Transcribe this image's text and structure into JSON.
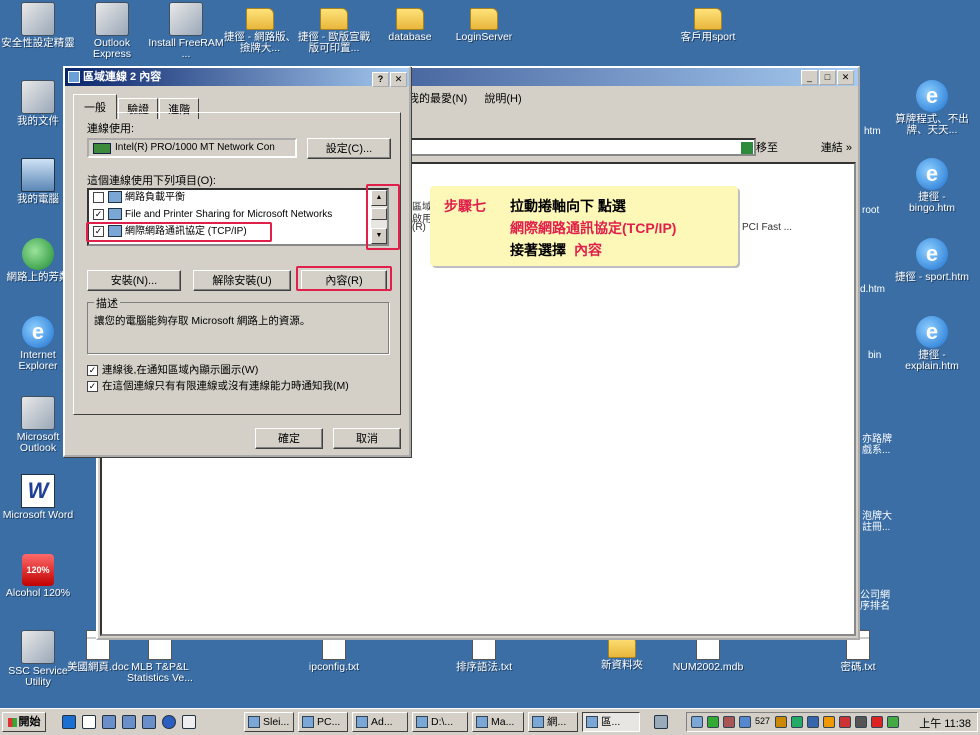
{
  "desktop_icons_top": [
    {
      "name": "desk-icon-security-settings",
      "label": "安全性設定精靈",
      "icon": "wizard-icon"
    },
    {
      "name": "desk-icon-outlook-express",
      "label": "Outlook Express",
      "icon": "outlook-express-icon"
    },
    {
      "name": "desk-icon-install-freeram",
      "label": "Install FreeRAM ...",
      "icon": "ram-chip-icon"
    },
    {
      "name": "desk-icon-shortcut-netplay",
      "label": "捷徑 - 網路版、撿牌大...",
      "icon": "folder-icon"
    },
    {
      "name": "desk-icon-shortcut-oubandian",
      "label": "捷徑 - 歐版宣戰版可印置...",
      "icon": "folder-icon"
    },
    {
      "name": "desk-icon-database",
      "label": "database",
      "icon": "folder-icon"
    },
    {
      "name": "desk-icon-loginserver",
      "label": "LoginServer",
      "icon": "folder-icon"
    },
    {
      "name": "desk-icon-client-sport",
      "label": "客戶用sport",
      "icon": "folder-icon"
    }
  ],
  "desktop_icons_left": [
    {
      "name": "desk-icon-my-documents",
      "label": "我的文件",
      "icon": "my-documents-icon"
    },
    {
      "name": "desk-icon-my-computer",
      "label": "我的電腦",
      "icon": "my-computer-icon"
    },
    {
      "name": "desk-icon-network-places",
      "label": "網路上的芳鄰",
      "icon": "network-icon"
    },
    {
      "name": "desk-icon-internet-explorer",
      "label": "Internet Explorer",
      "icon": "ie-icon"
    },
    {
      "name": "desk-icon-microsoft-outlook",
      "label": "Microsoft Outlook",
      "icon": "outlook-icon"
    },
    {
      "name": "desk-icon-microsoft-word",
      "label": "Microsoft Word",
      "icon": "word-icon"
    },
    {
      "name": "desk-icon-alcohol",
      "label": "Alcohol 120%",
      "icon": "alcohol-icon"
    }
  ],
  "desktop_icons_right": [
    {
      "name": "desk-icon-html-suanpai",
      "label": "算牌程式、不出牌、天天...",
      "icon": "html-doc-icon"
    },
    {
      "name": "desk-icon-html-bingo",
      "label": "捷徑 - bingo.htm",
      "icon": "html-doc-icon"
    },
    {
      "name": "desk-icon-html-sport",
      "label": "捷徑 - sport.htm",
      "icon": "html-doc-icon"
    },
    {
      "name": "desk-icon-html-explain",
      "label": "捷徑 - explain.htm",
      "icon": "html-doc-icon"
    }
  ],
  "desktop_icons_bottom": [
    {
      "name": "desk-icon-ssc-service",
      "label": "SSC Service Utility",
      "icon": "printer-icon"
    },
    {
      "name": "desk-icon-meiguo-doc",
      "label": "美國網頁.doc",
      "icon": "word-doc-icon"
    },
    {
      "name": "desk-icon-mlb-stats",
      "label": "MLB T&P&L Statistics Ve...",
      "icon": "doc-icon"
    },
    {
      "name": "desk-icon-ipconfig",
      "label": "ipconfig.txt",
      "icon": "text-file-icon"
    },
    {
      "name": "desk-icon-paixu",
      "label": "排序語法.txt",
      "icon": "text-file-icon"
    },
    {
      "name": "desk-icon-new-folder",
      "label": "新資料夾",
      "icon": "folder-icon"
    },
    {
      "name": "desk-icon-num2002",
      "label": "NUM2002.mdb",
      "icon": "access-db-icon"
    },
    {
      "name": "desk-icon-mima",
      "label": "密碼.txt",
      "icon": "text-file-icon"
    }
  ],
  "background_window": {
    "menu_items": [
      "我的最愛(N)",
      "說明(H)"
    ],
    "go_label": "移至",
    "links_label": "連結",
    "fragments": [
      "區域連",
      "啟用",
      "(R)",
      "PCI Fast ...",
      "htm",
      "root",
      "d.htm",
      "bin",
      "亦路牌",
      "戲系...",
      "泡牌大",
      "註冊...",
      "公司網",
      "序排名"
    ]
  },
  "dialog": {
    "title": "區域連線 2 內容",
    "help_btn": "?",
    "close_btn": "✕",
    "tabs": [
      "一般",
      "驗證",
      "進階"
    ],
    "connect_using_label": "連線使用:",
    "adapter_name": "Intel(R) PRO/1000 MT Network Con",
    "configure_button": "設定(C)...",
    "components_label": "這個連線使用下列項目(O):",
    "components": [
      {
        "label": "網路負載平衡",
        "checked": false
      },
      {
        "label": "File and Printer Sharing for Microsoft Networks",
        "checked": true
      },
      {
        "label": "網際網路通訊協定 (TCP/IP)",
        "checked": true
      }
    ],
    "install_button": "安裝(N)...",
    "uninstall_button": "解除安裝(U)",
    "properties_button": "內容(R)",
    "description_title": "描述",
    "description_text": "讓您的電腦能夠存取 Microsoft 網路上的資源。",
    "show_icon_label": "連線後,在通知區域內顯示圖示(W)",
    "notify_label": "在這個連線只有有限連線或沒有連線能力時通知我(M)",
    "ok_button": "確定",
    "cancel_button": "取消"
  },
  "callout": {
    "step": "步驟七",
    "line1": "拉動捲軸向下 點選",
    "line2": "網際網路通訊協定(TCP/IP)",
    "line3": "接著選擇",
    "line3_highlight": "內容"
  },
  "taskbar": {
    "start_label": "開始",
    "tasks": [
      "Slei...",
      "PC...",
      "Ad...",
      "D:\\...",
      "Ma...",
      "網...",
      "區..."
    ],
    "tray_number": "527",
    "clock": "上午 11:38"
  },
  "colors": {
    "desktop": "#3a6ea5",
    "titlebar": "#0a246a",
    "highlight_red": "#e0204a",
    "callout_bg": "#fdf7b8"
  }
}
